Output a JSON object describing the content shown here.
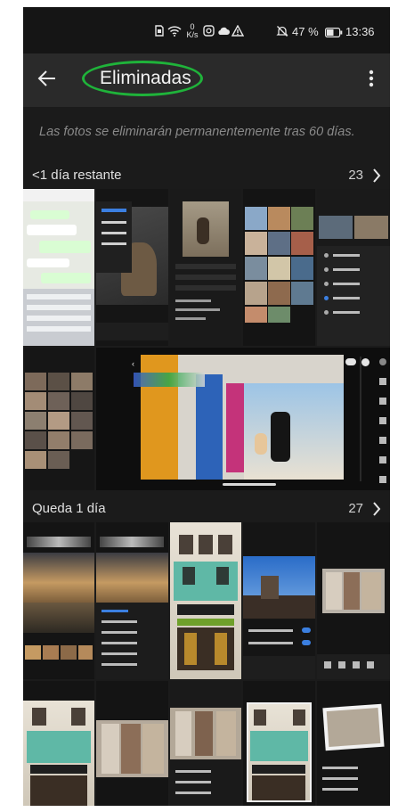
{
  "status_bar": {
    "icons": [
      "sim-card-icon",
      "wifi-icon",
      "data-rate-icon",
      "instagram-icon",
      "cloud-icon",
      "warning-icon",
      "mute-bell-icon",
      "battery-icon"
    ],
    "data_rate": "0 K/s",
    "battery": "47 %",
    "time": "13:36"
  },
  "app_bar": {
    "back_icon": "arrow-left-icon",
    "title": "Eliminadas",
    "highlight_color": "#1fb33a",
    "menu_icon": "more-vertical-icon"
  },
  "notice": "Las fotos se eliminarán permanentemente tras 60 días.",
  "sections": [
    {
      "label": "<1 día restante",
      "count": "23",
      "chevron": "chevron-right-icon"
    },
    {
      "label": "Queda 1 día",
      "count": "27",
      "chevron": "chevron-right-icon"
    }
  ],
  "photos": [
    {
      "name": "whatsapp-chat-screenshot",
      "kind": "screenshot"
    },
    {
      "name": "lightroom-menu-screenshot",
      "kind": "screenshot"
    },
    {
      "name": "photo-info-screenshot",
      "kind": "screenshot"
    },
    {
      "name": "album-grid-screenshot",
      "kind": "screenshot"
    },
    {
      "name": "filter-menu-screenshot",
      "kind": "screenshot"
    },
    {
      "name": "photo-grid-screenshot",
      "kind": "screenshot"
    },
    {
      "name": "lightroom-editor-screenshot",
      "kind": "screenshot"
    },
    {
      "name": "sunset-sea-edit",
      "kind": "screenshot"
    },
    {
      "name": "sunset-sea-menu",
      "kind": "screenshot"
    },
    {
      "name": "casa-oriental-building",
      "kind": "photo"
    },
    {
      "name": "street-sky-edit",
      "kind": "screenshot"
    },
    {
      "name": "porto-facades-edit",
      "kind": "screenshot"
    },
    {
      "name": "casa-oriental-edit",
      "kind": "screenshot"
    },
    {
      "name": "porto-facades-photo",
      "kind": "photo"
    },
    {
      "name": "porto-street-edit",
      "kind": "screenshot"
    },
    {
      "name": "casa-oriental-crop",
      "kind": "screenshot"
    },
    {
      "name": "porto-facades-crop",
      "kind": "screenshot"
    }
  ],
  "colors": {
    "background": "#1b1b1b",
    "app_bar": "#2a2a2a",
    "text": "#e0e0e0",
    "muted_text": "#8a8a8a"
  }
}
